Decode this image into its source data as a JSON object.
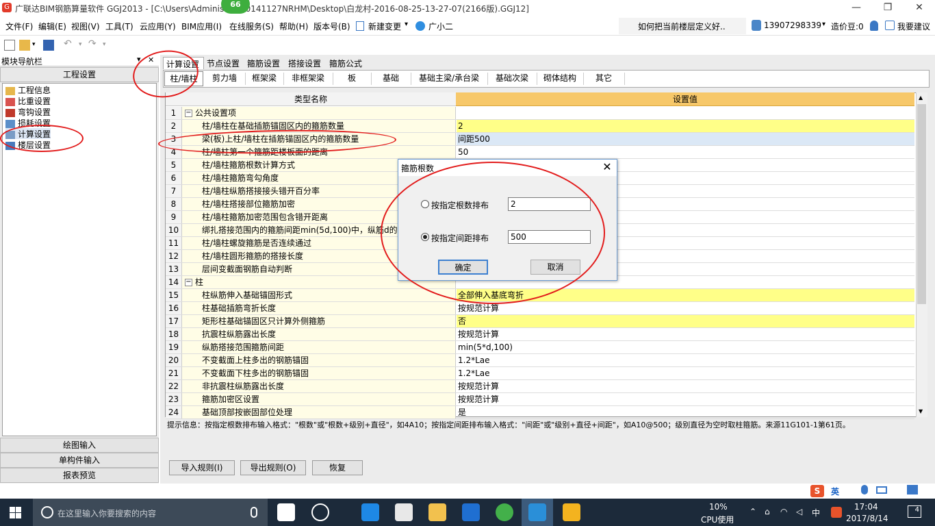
{
  "window": {
    "title": "广联达BIM钢筋算量软件 GGJ2013 - [C:\\Users\\Adminis PC-20141127NRHM\\Desktop\\白龙村-2016-08-25-13-27-07(2166版).GGJ12]",
    "badge": "66",
    "minimize": "—",
    "restore": "❐",
    "close": "✕"
  },
  "menubar": {
    "items": [
      "文件(F)",
      "编辑(E)",
      "视图(V)",
      "工具(T)",
      "云应用(Y)",
      "BIM应用(I)",
      "在线服务(S)",
      "帮助(H)",
      "版本号(B)",
      "新建变更",
      "广小二"
    ],
    "search_text": "如何把当前楼层定义好..",
    "phone": "13907298339",
    "coins": "造价豆:0",
    "suggest": "我要建议"
  },
  "nav": {
    "title": "模块导航栏",
    "pin": "▾",
    "close": "✕",
    "project": "工程设置",
    "tree": [
      "工程信息",
      "比重设置",
      "弯钩设置",
      "损耗设置",
      "计算设置",
      "楼层设置"
    ],
    "bottom": [
      "绘图输入",
      "单构件输入",
      "报表预览"
    ]
  },
  "tabs": [
    "计算设置",
    "节点设置",
    "箍筋设置",
    "搭接设置",
    "箍筋公式"
  ],
  "subtabs": [
    "柱/墙柱",
    "剪力墙",
    "框架梁",
    "非框架梁",
    "板",
    "基础",
    "基础主梁/承台梁",
    "基础次梁",
    "砌体结构",
    "其它"
  ],
  "grid": {
    "col_name": "类型名称",
    "col_value": "设置值",
    "rows": [
      {
        "n": "1",
        "name": "公共设置项",
        "value": "",
        "group": true
      },
      {
        "n": "2",
        "name": "柱/墙柱在基础插筋锚固区内的箍筋数量",
        "value": "2",
        "hl": "yellow"
      },
      {
        "n": "3",
        "name": "梁(板)上柱/墙柱在插筋锚固区内的箍筋数量",
        "value": "间距500",
        "hl": "blue"
      },
      {
        "n": "4",
        "name": "柱/墙柱第一个箍筋距楼板面的距离",
        "value": "50"
      },
      {
        "n": "5",
        "name": "柱/墙柱箍筋根数计算方式",
        "value": ""
      },
      {
        "n": "6",
        "name": "柱/墙柱箍筋弯勾角度",
        "value": ""
      },
      {
        "n": "7",
        "name": "柱/墙柱纵筋搭接接头错开百分率",
        "value": ""
      },
      {
        "n": "8",
        "name": "柱/墙柱搭接部位箍筋加密",
        "value": ""
      },
      {
        "n": "9",
        "name": "柱/墙柱箍筋加密范围包含错开距离",
        "value": ""
      },
      {
        "n": "10",
        "name": "绑扎搭接范围内的箍筋间距min(5d,100)中，纵筋d的取",
        "value": ""
      },
      {
        "n": "11",
        "name": "柱/墙柱螺旋箍筋是否连续通过",
        "value": ""
      },
      {
        "n": "12",
        "name": "柱/墙柱圆形箍筋的搭接长度",
        "value": ""
      },
      {
        "n": "13",
        "name": "层间变截面钢筋自动判断",
        "value": ""
      },
      {
        "n": "14",
        "name": "柱",
        "value": "",
        "group": true
      },
      {
        "n": "15",
        "name": "柱纵筋伸入基础锚固形式",
        "value": "全部伸入基底弯折",
        "hl": "yellow"
      },
      {
        "n": "16",
        "name": "柱基础插筋弯折长度",
        "value": "按规范计算"
      },
      {
        "n": "17",
        "name": "矩形柱基础锚固区只计算外侧箍筋",
        "value": "否",
        "hl": "yellow"
      },
      {
        "n": "18",
        "name": "抗震柱纵筋露出长度",
        "value": "按规范计算"
      },
      {
        "n": "19",
        "name": "纵筋搭接范围箍筋间距",
        "value": "min(5*d,100)"
      },
      {
        "n": "20",
        "name": "不变截面上柱多出的钢筋锚固",
        "value": "1.2*Lae"
      },
      {
        "n": "21",
        "name": "不变截面下柱多出的钢筋锚固",
        "value": "1.2*Lae"
      },
      {
        "n": "22",
        "name": "非抗震柱纵筋露出长度",
        "value": "按规范计算"
      },
      {
        "n": "23",
        "name": "箍筋加密区设置",
        "value": "按规范计算"
      },
      {
        "n": "24",
        "name": "基础顶部按嵌固部位处理",
        "value": "是"
      }
    ]
  },
  "hint": "提示信息：按指定根数排布输入格式：\"根数\"或\"根数+级别+直径\"，如4A10；按指定间距排布输入格式：\"间距\"或\"级别+直径+间距\"，如A10@500；级别直径为空时取柱箍筋。来源11G101-1第61页。",
  "buttons": {
    "import": "导入规则(I)",
    "export": "导出规则(O)",
    "restore": "恢复"
  },
  "dialog": {
    "title": "箍筋根数",
    "close": "✕",
    "opt1_label": "按指定根数排布",
    "opt1_value": "2",
    "opt2_label": "按指定间距排布",
    "opt2_value": "500",
    "selected": "opt2",
    "ok": "确定",
    "cancel": "取消"
  },
  "taskbar": {
    "search_placeholder": "在这里输入你要搜索的内容",
    "cpu_percent": "10%",
    "cpu_label": "CPU使用",
    "ime": "中",
    "time": "17:04",
    "date": "2017/8/14",
    "notifications": "4"
  },
  "ime_bar": {
    "lang": "英"
  },
  "colors": {
    "highlight_yellow": "#ffff88",
    "selected_blue": "#dbe8f6",
    "annotation_red": "#e21b1b",
    "header_orange": "#f7c86a"
  }
}
